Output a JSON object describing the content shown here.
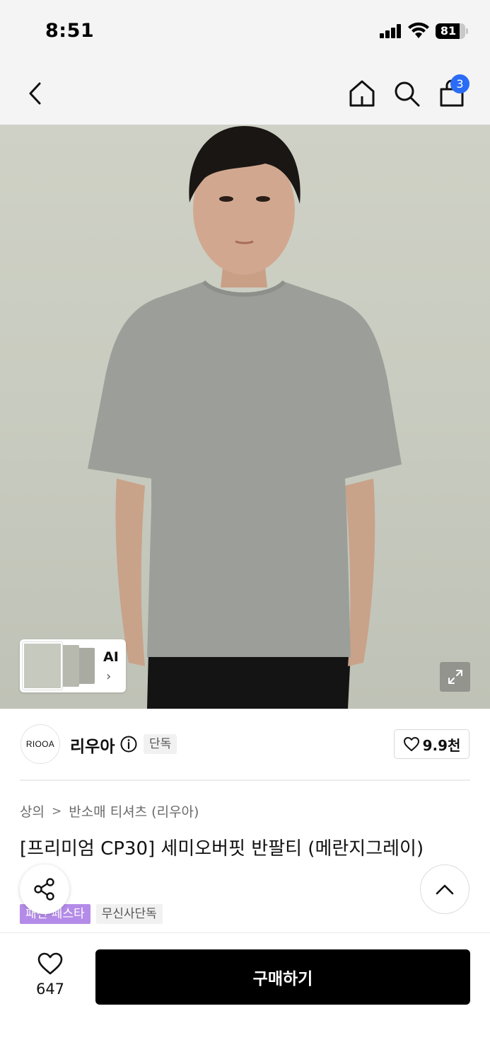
{
  "status_bar": {
    "time": "8:51",
    "battery_pct": "81",
    "battery_level": 0.81
  },
  "nav": {
    "back_icon": "chevron-left-icon",
    "home_icon": "home-icon",
    "search_icon": "search-icon",
    "cart_icon": "shopping-bag-icon",
    "cart_badge": "3",
    "accent_color": "#2b6cf6"
  },
  "gallery": {
    "ai_label": "AI",
    "ai_chevron": "›",
    "expand_icon": "expand-icon"
  },
  "brand": {
    "logo_text": "RIOOA",
    "name": "리우아",
    "exclusive_badge": "단독",
    "like_count": "9.9천"
  },
  "product": {
    "breadcrumb": [
      "상의",
      "반소매 티셔츠 (리우아)"
    ],
    "breadcrumb_separator": ">",
    "title": "[프리미엄 CP30] 세미오버핏 반팔티 (메란지그레이)",
    "tags": [
      {
        "label": "패션 페스타",
        "color": "#b48be8"
      },
      {
        "label": "무신사단독",
        "color": "#f1f1f1"
      }
    ]
  },
  "floating": {
    "share_icon": "share-icon",
    "scroll_top_icon": "chevron-up-icon"
  },
  "bottom_bar": {
    "wish_count": "647",
    "buy_label": "구매하기"
  }
}
